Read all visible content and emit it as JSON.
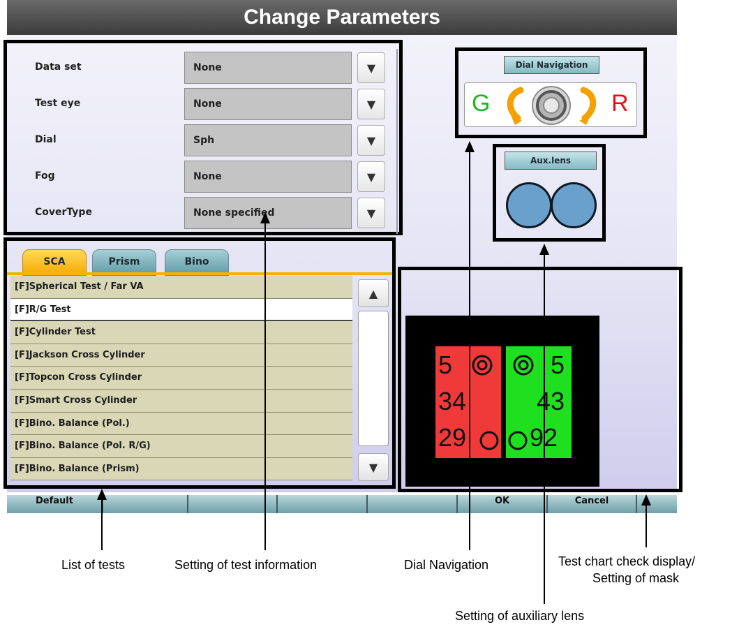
{
  "header": {
    "title": "Change Parameters"
  },
  "settings": {
    "rows": [
      {
        "label": "Data set",
        "value": "None"
      },
      {
        "label": "Test eye",
        "value": "None"
      },
      {
        "label": "Dial",
        "value": "Sph"
      },
      {
        "label": "Fog",
        "value": "None"
      },
      {
        "label": "CoverType",
        "value": "None specified"
      }
    ],
    "dropdown_glyph": "▼"
  },
  "tabs": [
    {
      "label": "SCA",
      "active": true
    },
    {
      "label": "Prism",
      "active": false
    },
    {
      "label": "Bino",
      "active": false
    }
  ],
  "tests": {
    "items": [
      "[F]Spherical Test / Far VA",
      "[F]R/G Test",
      "[F]Cylinder Test",
      "[F]Jackson Cross Cylinder",
      "[F]Topcon Cross Cylinder",
      "[F]Smart Cross Cylinder",
      "[F]Bino. Balance (Pol.)",
      "[F]Bino. Balance (Pol. R/G)",
      "[F]Bino. Balance (Prism)"
    ],
    "selected_index": 1,
    "scroll_up_glyph": "▲",
    "scroll_down_glyph": "▼"
  },
  "dial_navigation": {
    "title": "Dial Navigation",
    "left_label": "G",
    "right_label": "R"
  },
  "aux_lens": {
    "title": "Aux.lens",
    "lens_color": "#6aa0cc"
  },
  "chart": {
    "red_panel": {
      "row1": "5",
      "row2": "34",
      "row3": "29"
    },
    "green_panel": {
      "row1": "5",
      "row2": "43",
      "row3": "92"
    },
    "colors": {
      "red": "#f03a3a",
      "green": "#1ee01e"
    }
  },
  "bottom_bar": {
    "buttons": [
      "Default",
      "",
      "",
      "",
      "",
      "OK",
      "Cancel",
      ""
    ]
  },
  "callouts": {
    "list_of_tests": "List of tests",
    "setting_test_info": "Setting of test information",
    "dial_navigation": "Dial Navigation",
    "test_chart_line1": "Test chart check display/",
    "test_chart_line2": "Setting of mask",
    "aux_lens": "Setting of auxiliary lens"
  },
  "colors": {
    "title_bar": "#4a4a4a",
    "tab_active": "#f5a900",
    "tab_inactive": "#5f9aa6",
    "list_item_bg": "#d9d7b6"
  }
}
